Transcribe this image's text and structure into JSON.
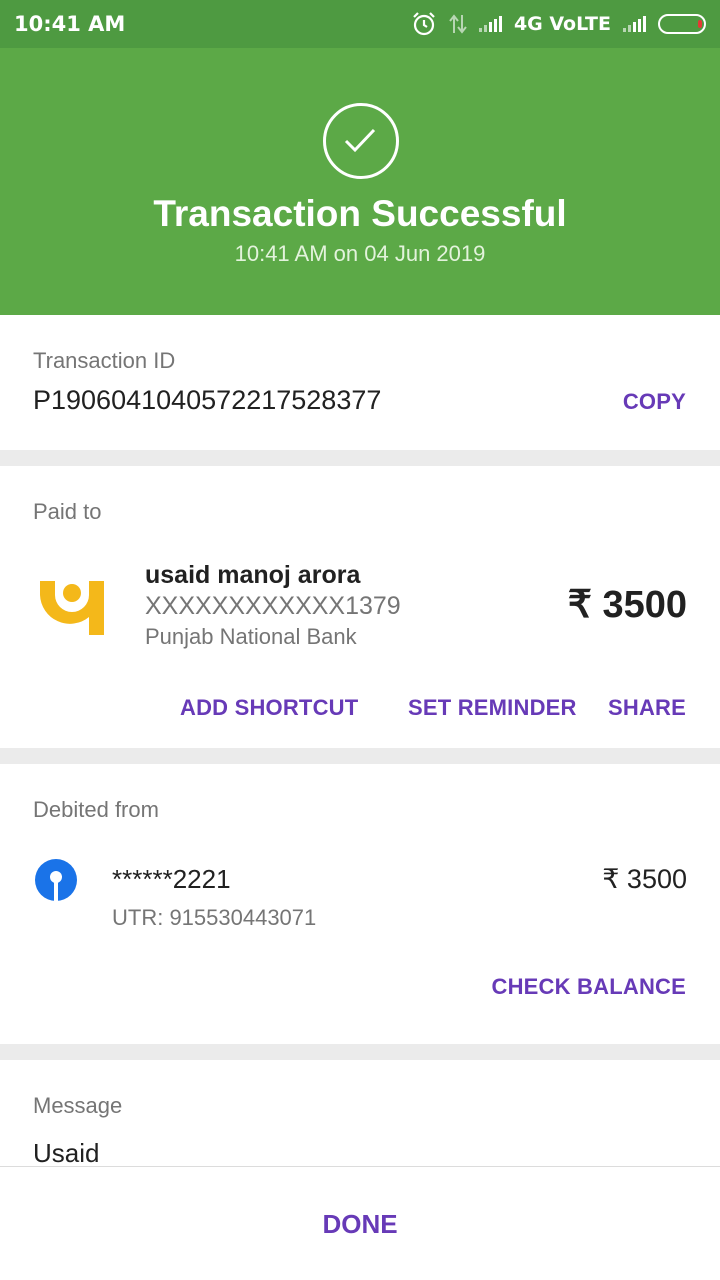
{
  "status_bar": {
    "time": "10:41 AM",
    "network": "4G VoLTE",
    "icons": [
      "alarm-icon",
      "data-arrows-icon",
      "signal-icon",
      "battery-icon"
    ]
  },
  "header": {
    "title": "Transaction Successful",
    "subtitle": "10:41 AM on 04 Jun 2019",
    "icon": "check-circle-icon",
    "background_color": "#5ca947"
  },
  "transaction": {
    "label": "Transaction ID",
    "id": "P1906041040572217528377",
    "copy_label": "COPY"
  },
  "paid_to": {
    "label": "Paid to",
    "name": "usaid manoj arora",
    "account": "XXXXXXXXXXXX1379",
    "bank": "Punjab National Bank",
    "amount": "₹ 3500",
    "bank_logo": "pnb-logo",
    "actions": {
      "add_shortcut": "ADD SHORTCUT",
      "set_reminder": "SET REMINDER",
      "share": "SHARE"
    }
  },
  "debited_from": {
    "label": "Debited from",
    "account": "******2221",
    "utr": "UTR: 915530443071",
    "amount": "₹ 3500",
    "bank_logo": "sbi-logo",
    "check_balance": "CHECK BALANCE"
  },
  "message": {
    "label": "Message",
    "text": "Usaid"
  },
  "footer": {
    "done_label": "DONE"
  },
  "colors": {
    "accent": "#673ab7",
    "success": "#5ca947"
  }
}
